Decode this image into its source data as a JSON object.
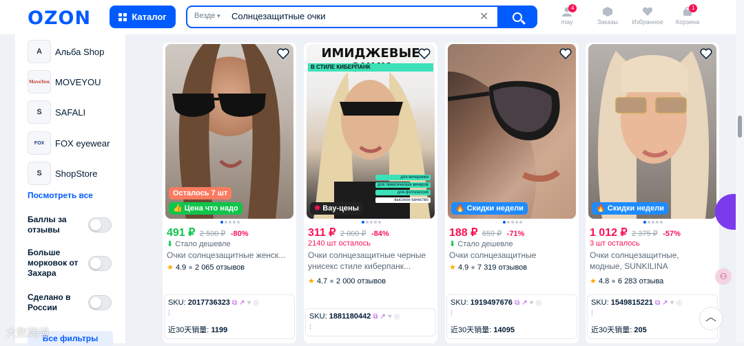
{
  "header": {
    "logo": "OZON",
    "catalog_label": "Каталог",
    "search_scope": "Везде",
    "search_query": "Солнцезащитные очки",
    "items": [
      {
        "label": "may",
        "badge": "4",
        "icon": "user-icon"
      },
      {
        "label": "Заказы",
        "badge": "",
        "icon": "box-icon"
      },
      {
        "label": "Избранное",
        "badge": "",
        "icon": "heart-icon"
      },
      {
        "label": "Корзина",
        "badge": "1",
        "icon": "cart-icon"
      }
    ]
  },
  "sidebar": {
    "brands": [
      {
        "logo": "A",
        "name": "Альба Shop"
      },
      {
        "logo": "MoveYou",
        "name": "MOVEYOU"
      },
      {
        "logo": "S",
        "name": "SAFALI"
      },
      {
        "logo": "FOX",
        "name": "FOX eyewear"
      },
      {
        "logo": "S",
        "name": "ShopStore"
      }
    ],
    "see_all": "Посмотреть все",
    "toggles": [
      "Баллы за отзывы",
      "Больше морковок от Захара",
      "Сделано в России"
    ],
    "all_filters": "Все фильтры"
  },
  "products": [
    {
      "left_badge": "Осталось 7 шт",
      "promo": "Цена что надо",
      "price": "491 ₽",
      "old_price": "2 500 ₽",
      "discount": "-80%",
      "info": "Стало дешевле",
      "title": "Очки солнцезащитные женск...",
      "title2": "",
      "rating": "4.9",
      "reviews": "2 065 отзывов",
      "sku": "2017736323",
      "sales": "1199"
    },
    {
      "left_badge": "",
      "photo_text": "ИМИДЖЕВЫЕ ОЧКИ",
      "photo_text2": "В СТИЛЕ КИБЕРПАНК",
      "photo_tags": [
        "для вечеринки",
        "для тематических вечеров",
        "для фотосессии",
        "высокое качество"
      ],
      "promo": "Вау-цены",
      "price": "311 ₽",
      "old_price": "2 000 ₽",
      "discount": "-84%",
      "info": "2140 шт осталось",
      "title": "Очки солнцезащитные черные",
      "title2": "унисекс стиле киберпанк...",
      "rating": "4.7",
      "reviews": "2 000 отзывов",
      "sku": "1881180442",
      "sales": ""
    },
    {
      "left_badge": "",
      "promo": "Скидки недели",
      "price": "188 ₽",
      "old_price": "659 ₽",
      "discount": "-71%",
      "info": "Стало дешевле",
      "title": "Очки солнцезащитные",
      "title2": "",
      "rating": "4.9",
      "reviews": "7 319 отзывов",
      "sku": "1919497676",
      "sales": "14095"
    },
    {
      "left_badge": "",
      "promo": "Скидки недели",
      "price": "1 012 ₽",
      "old_price": "2 375 ₽",
      "discount": "-57%",
      "info": "3 шт осталось",
      "title": "Очки солнцезащитные,",
      "title2": "модные, SUNKILINA",
      "rating": "4.8",
      "reviews": "6 283 отзыва",
      "sku": "1549815221",
      "sales": "205"
    }
  ],
  "labels": {
    "sku_prefix": "SKU:",
    "sales_prefix": "近30天销量:"
  },
  "watermark": "大数跨境",
  "colors": {
    "accent": "#005bff",
    "price_green": "#10c44c",
    "price_pink": "#f91155",
    "promo_green": "#10c44c",
    "promo_dark": "#222222",
    "promo_blue": "#1e8bff"
  }
}
